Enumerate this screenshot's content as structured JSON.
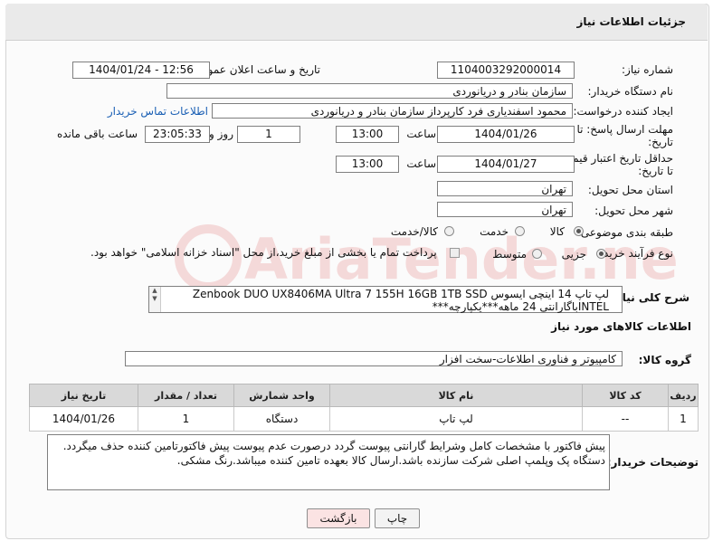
{
  "header": {
    "title": "جزئیات اطلاعات نیاز"
  },
  "form": {
    "need_number_label": "شماره نیاز:",
    "need_number": "1104003292000014",
    "announce_label": "تاریخ و ساعت اعلان عمومی:",
    "announce_value": "1404/01/24 - 12:56",
    "buyer_org_label": "نام دستگاه خریدار:",
    "buyer_org": "سازمان بنادر و دریانوردی",
    "requester_label": "ایجاد کننده درخواست:",
    "requester": "محمود اسفندیاری فرد کارپرداز سازمان بنادر و دریانوردی",
    "contact_link": "اطلاعات تماس خریدار",
    "deadline_label_1": "مهلت ارسال پاسخ: تا",
    "deadline_label_2": "تاریخ:",
    "deadline_date": "1404/01/26",
    "hour_label": "ساعت",
    "deadline_time": "13:00",
    "days_value": "1",
    "days_label": "روز و",
    "remaining_time": "23:05:33",
    "remaining_label": "ساعت باقی مانده",
    "validity_label_1": "حداقل تاریخ اعتبار قیمت:",
    "validity_label_2": "تا تاریخ:",
    "validity_date": "1404/01/27",
    "validity_time": "13:00",
    "province_label": "استان محل تحویل:",
    "province": "تهران",
    "city_label": "شهر محل تحویل:",
    "city": "تهران",
    "category_label": "طبقه بندی موضوعی:",
    "category_options": [
      "کالا",
      "خدمت",
      "کالا/خدمت"
    ],
    "category_selected": "کالا",
    "process_label": "نوع فرآیند خرید :",
    "process_options": [
      "جزیی",
      "متوسط"
    ],
    "process_selected": "جزیی",
    "payment_note": "پرداخت تمام یا بخشی از مبلغ خرید،از محل \"اسناد خزانه اسلامی\" خواهد بود."
  },
  "description": {
    "label": "شرح کلی نیاز:",
    "text": "لپ تاپ 14 اینچی ایسوس Zenbook DUO UX8406MA Ultra 7 155H 16GB 1TB SSD INTELباگارانتی 24 ماهه***یکپارچه***"
  },
  "goods_info": {
    "title": "اطلاعات کالاهای مورد نیاز",
    "group_label": "گروه کالا:",
    "group_value": "کامپیوتر و فناوری اطلاعات-سخت افزار"
  },
  "table": {
    "headers": [
      "ردیف",
      "کد کالا",
      "نام کالا",
      "واحد شمارش",
      "تعداد / مقدار",
      "تاریخ نیاز"
    ],
    "rows": [
      [
        "1",
        "--",
        "لپ تاپ",
        "دستگاه",
        "1",
        "1404/01/26"
      ]
    ]
  },
  "buyer_notes": {
    "label": "توضیحات خریدار:",
    "text": "پیش فاکتور با مشخصات کامل وشرایط گارانتی پیوست گردد درصورت عدم پیوست پیش فاکتورتامین کننده حذف میگردد. دستگاه پک وپلمپ اصلی شرکت سازنده باشد.ارسال کالا بعهده تامین کننده میباشد.رنگ مشکی."
  },
  "buttons": {
    "print": "چاپ",
    "back": "بازگشت"
  },
  "watermark": "AriaTender.net",
  "colors": {
    "link": "#1a5fb4",
    "header_bg": "#eaeaea",
    "back_button_bg": "#fbe3e3"
  }
}
